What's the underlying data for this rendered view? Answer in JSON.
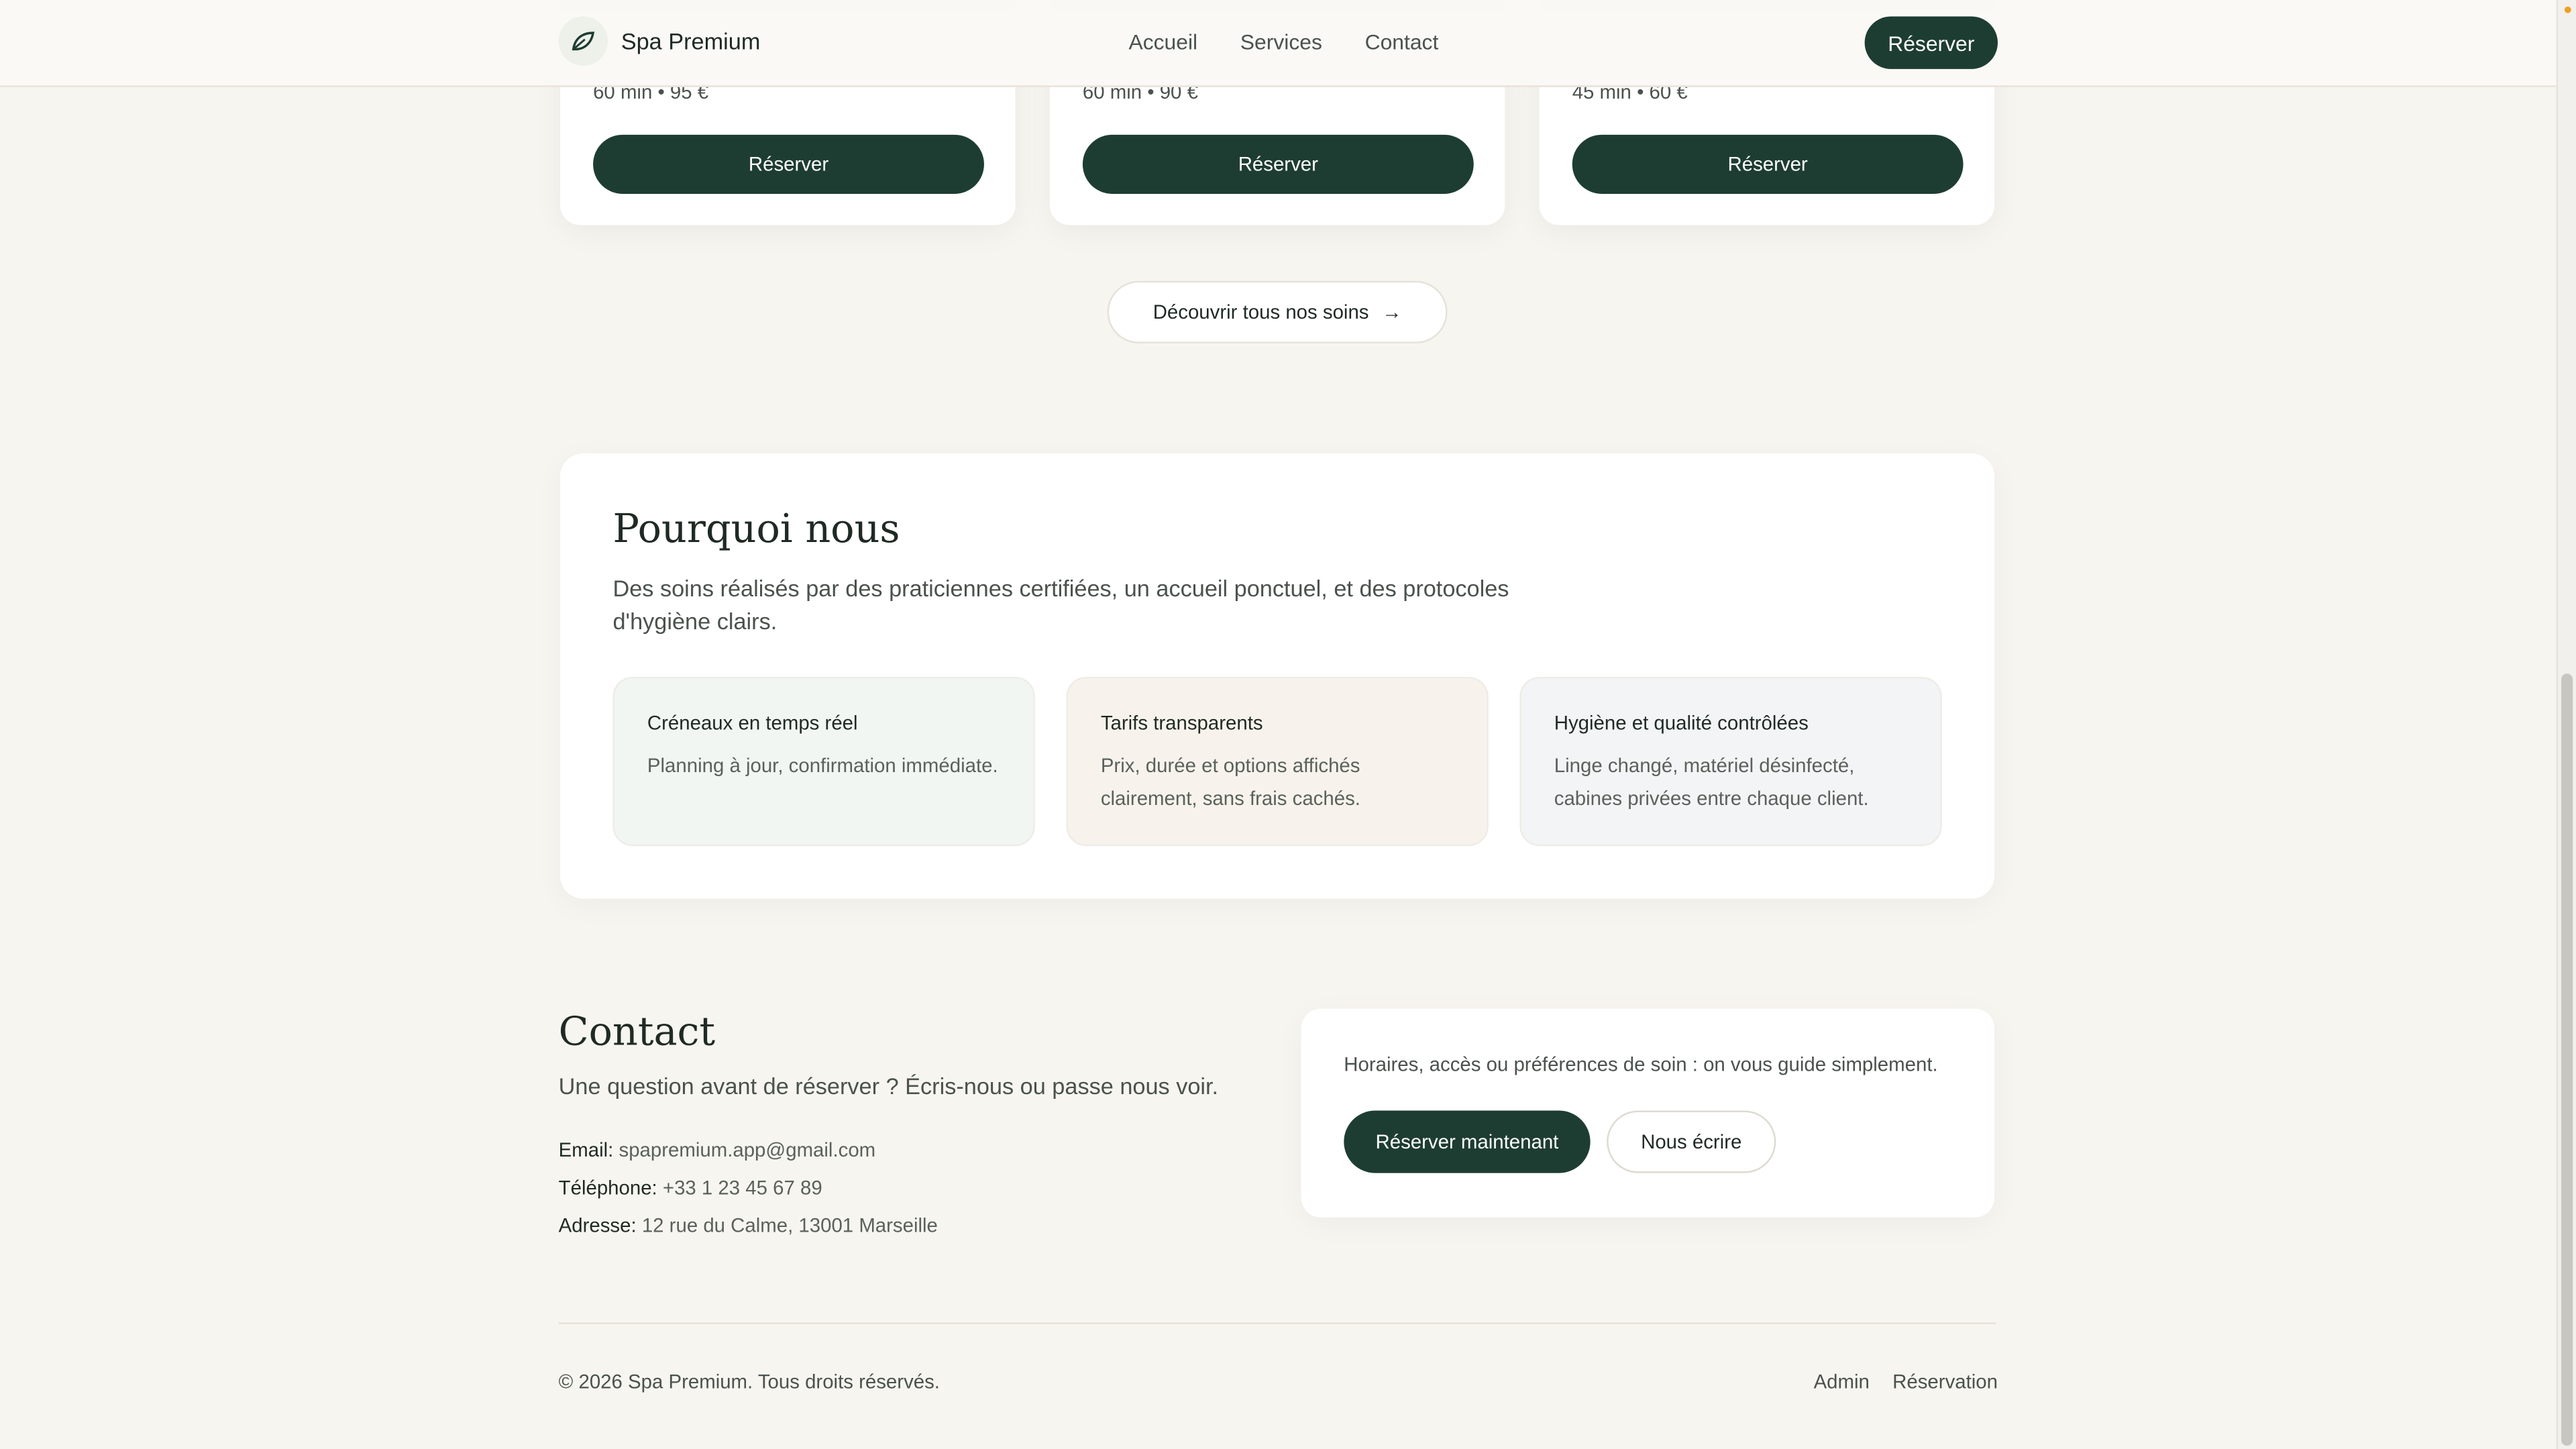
{
  "header": {
    "brand_name": "Spa Premium",
    "nav": [
      "Accueil",
      "Services",
      "Contact"
    ],
    "cta_label": "Réserver"
  },
  "services": {
    "cards": [
      {
        "meta": "60 min • 95 €",
        "button_label": "Réserver"
      },
      {
        "meta": "60 min • 90 €",
        "button_label": "Réserver"
      },
      {
        "meta": "45 min • 60 €",
        "button_label": "Réserver"
      }
    ],
    "discover_label": "Découvrir tous nos soins",
    "discover_arrow": "→"
  },
  "why": {
    "title": "Pourquoi nous",
    "description": "Des soins réalisés par des praticiennes certifiées, un accueil ponctuel, et des protocoles d'hygiène clairs.",
    "features": [
      {
        "title": "Créneaux en temps réel",
        "text": "Planning à jour, confirmation immédiate.",
        "color": "#f1f6f3"
      },
      {
        "title": "Tarifs transparents",
        "text": "Prix, durée et options affichés clairement, sans frais cachés.",
        "color": "#f7f3ec"
      },
      {
        "title": "Hygiène et qualité contrôlées",
        "text": "Linge changé, matériel désinfecté, cabines privées entre chaque client.",
        "color": "#f3f4f5"
      }
    ]
  },
  "contact": {
    "title": "Contact",
    "lead": "Une question avant de réserver ? Écris-nous ou passe nous voir.",
    "email_label": "Email:",
    "email_value": "spapremium.app@gmail.com",
    "phone_label": "Téléphone:",
    "phone_value": "+33 1 23 45 67 89",
    "address_label": "Adresse:",
    "address_value": "12 rue du Calme, 13001 Marseille",
    "box_text": "Horaires, accès ou préférences de soin : on vous guide simplement.",
    "primary_label": "Réserver maintenant",
    "secondary_label": "Nous écrire"
  },
  "footer": {
    "copyright": "© 2026 Spa Premium. Tous droits réservés.",
    "links": [
      "Admin",
      "Réservation"
    ]
  },
  "colors": {
    "accent": "#1e3d32",
    "background": "#f7f5f0"
  },
  "icons": {
    "brand": "leaf-icon"
  }
}
